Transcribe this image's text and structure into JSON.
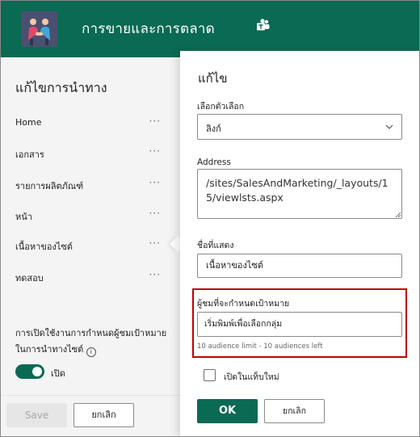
{
  "header": {
    "site_title": "การขายและการตลาด",
    "icons": {
      "logo": "people-handshake-logo",
      "teams": "teams-icon"
    },
    "colors": {
      "header_bg": "#0b6a53"
    }
  },
  "nav_panel": {
    "title": "แก้ไขการนำทาง",
    "items": [
      {
        "label": "Home",
        "more": "···"
      },
      {
        "label": "เอกสาร",
        "more": "···"
      },
      {
        "label": "รายการผลิตภัณฑ์",
        "more": "···"
      },
      {
        "label": "หน้า",
        "more": "···"
      },
      {
        "label": "เนื้อหาของไซต์",
        "more": "···"
      },
      {
        "label": "ทดสอบ",
        "more": "···"
      }
    ],
    "audience_setting": {
      "label": "การเปิดใช้งานการกำหนดผู้ชมเป้าหมายในการนำทางไซต์",
      "info_glyph": "i",
      "toggle_state": "on",
      "toggle_label": "เปิด"
    },
    "footer": {
      "save_label": "Save",
      "cancel_label": "ยกเลิก"
    }
  },
  "edit_panel": {
    "title": "แก้ไข",
    "choose_option": {
      "label": "เลือกตัวเลือก",
      "value": "ลิงก์"
    },
    "address": {
      "label": "Address",
      "value": "/sites/SalesAndMarketing/_layouts/15/viewlsts.aspx"
    },
    "display_name": {
      "label": "ชื่อที่แสดง",
      "value": "เนื้อหาของไซต์"
    },
    "audience": {
      "label": "ผู้ชมที่จะกำหนดเป้าหมาย",
      "placeholder": "เริ่มพิมพ์เพื่อเลือกกลุ่ม",
      "hint": "10 audience limit - 10 audiences left",
      "highlight_color": "#c00000"
    },
    "new_tab": {
      "label": "เปิดในแท็บใหม่",
      "checked": false
    },
    "footer": {
      "ok_label": "OK",
      "cancel_label": "ยกเลิก"
    }
  }
}
